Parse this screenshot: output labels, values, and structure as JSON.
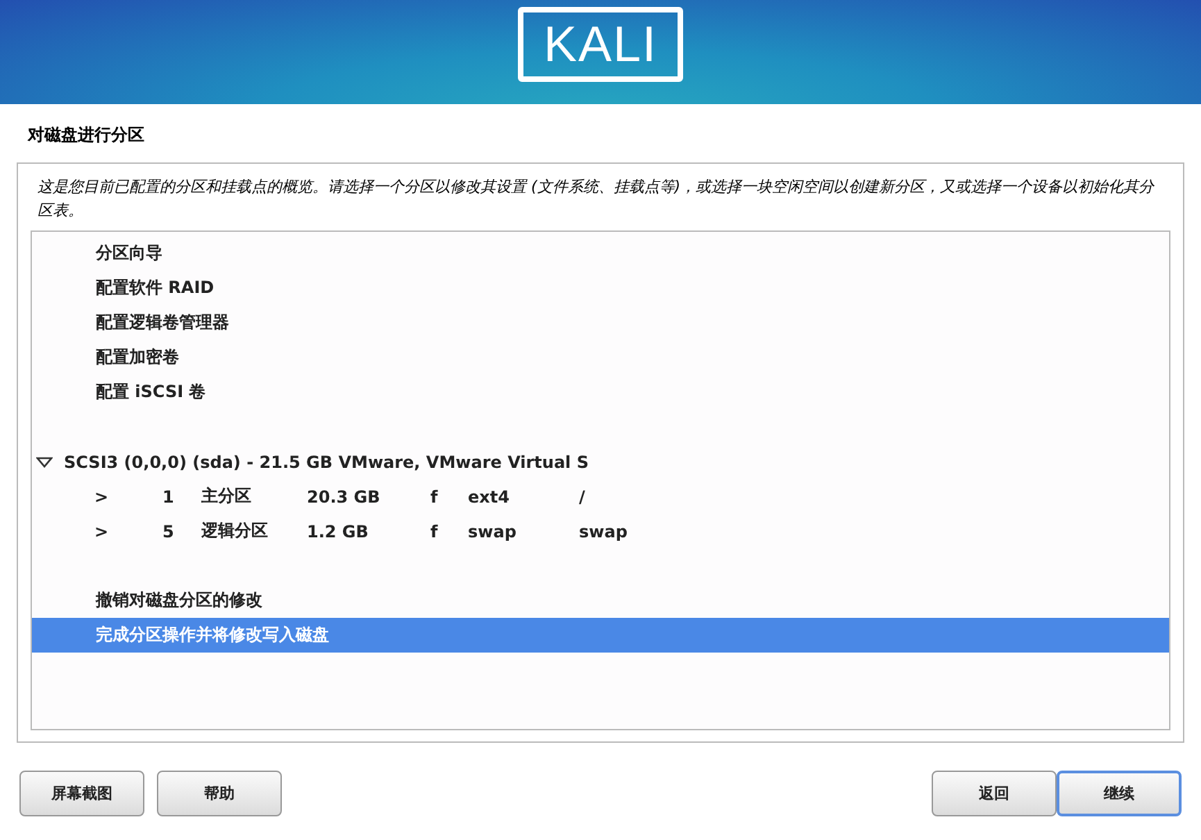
{
  "header": {
    "logo": "KALI"
  },
  "page_title": "对磁盘进行分区",
  "description": "这是您目前已配置的分区和挂载点的概览。请选择一个分区以修改其设置 (文件系统、挂载点等)，或选择一块空闲空间以创建新分区，又或选择一个设备以初始化其分区表。",
  "groups": [
    [
      {
        "kind": "action",
        "label": "分区向导",
        "selected": false
      },
      {
        "kind": "action",
        "label": "配置软件 RAID",
        "selected": false
      },
      {
        "kind": "action",
        "label": "配置逻辑卷管理器",
        "selected": false
      },
      {
        "kind": "action",
        "label": "配置加密卷",
        "selected": false
      },
      {
        "kind": "action",
        "label": "配置 iSCSI 卷",
        "selected": false
      }
    ],
    [
      {
        "kind": "disk",
        "label": "SCSI3 (0,0,0) (sda) - 21.5 GB VMware, VMware Virtual S",
        "expanded": true,
        "selected": false
      },
      {
        "kind": "partition",
        "marker": ">",
        "number": "1",
        "type": "主分区",
        "size": "20.3 GB",
        "flag": "f",
        "filesystem": "ext4",
        "mount": "/",
        "selected": false
      },
      {
        "kind": "partition",
        "marker": ">",
        "number": "5",
        "type": "逻辑分区",
        "size": "1.2 GB",
        "flag": "f",
        "filesystem": "swap",
        "mount": "swap",
        "selected": false
      }
    ],
    [
      {
        "kind": "action",
        "label": "撤销对磁盘分区的修改",
        "selected": false
      },
      {
        "kind": "action",
        "label": "完成分区操作并将修改写入磁盘",
        "selected": true
      }
    ]
  ],
  "buttons_left": [
    {
      "label": "屏幕截图",
      "focused": false
    },
    {
      "label": "帮助",
      "focused": false
    }
  ],
  "buttons_right": [
    {
      "label": "返回",
      "focused": false
    },
    {
      "label": "继续",
      "focused": true
    }
  ]
}
